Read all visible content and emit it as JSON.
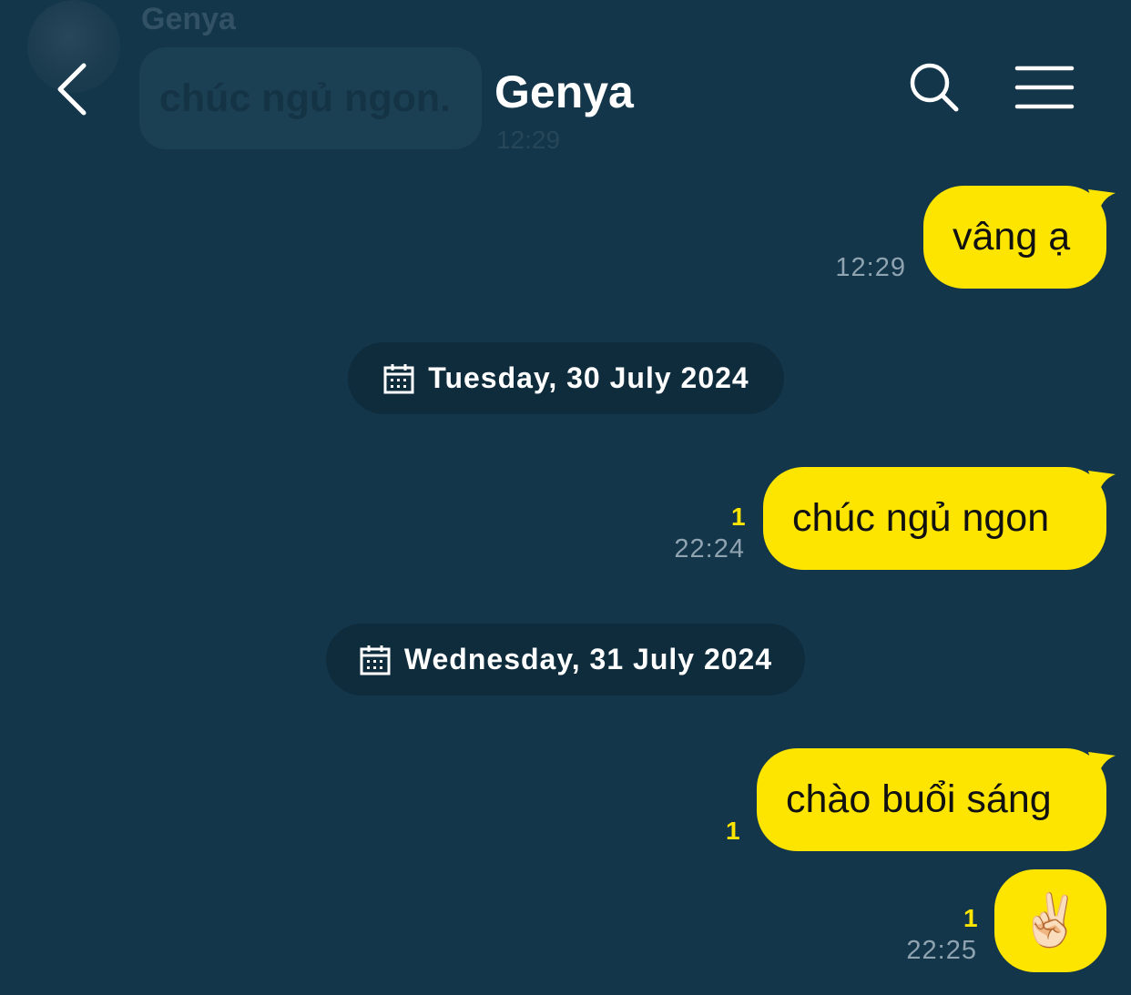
{
  "header": {
    "title": "Genya",
    "icons": [
      "back-chevron-icon",
      "search-icon",
      "menu-icon"
    ]
  },
  "ghost_message": {
    "sender": "Genya",
    "text": "chúc ngủ ngon.",
    "time": "12:29"
  },
  "messages": [
    {
      "text": "vâng ạ",
      "time": "12:29",
      "unread": ""
    },
    {
      "date_separator": "Tuesday, 30 July 2024"
    },
    {
      "text": "chúc ngủ ngon",
      "time": "22:24",
      "unread": "1"
    },
    {
      "date_separator": "Wednesday, 31 July 2024"
    },
    {
      "text": "chào buổi sáng",
      "time": "",
      "unread": "1"
    },
    {
      "text": "✌🏻",
      "time": "22:25",
      "unread": "1"
    }
  ],
  "colors": {
    "background": "#13364a",
    "bubble": "#fee500",
    "unread": "#fee500",
    "time": "#8fa3b0",
    "pill": "#0f2c3d"
  }
}
